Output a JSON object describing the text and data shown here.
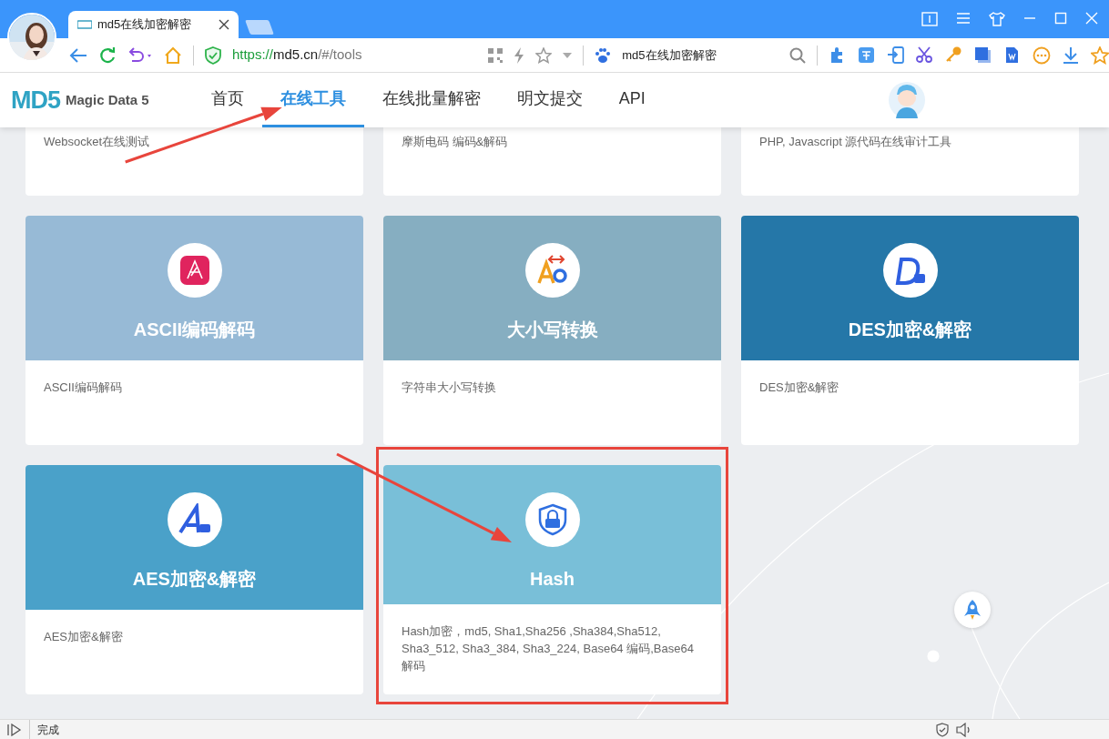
{
  "browser": {
    "tabs": [
      {
        "title": "md5在线加密解密",
        "selected": true
      }
    ],
    "address": {
      "scheme": "https://",
      "host": "md5.cn",
      "path": "/#/tools"
    },
    "search": {
      "value": "md5在线加密解密"
    }
  },
  "site": {
    "logo": {
      "mark": "MD5",
      "name": "Magic Data 5"
    },
    "nav": [
      {
        "label": "首页",
        "selected": false,
        "pointed": false
      },
      {
        "label": "在线工具",
        "selected": true,
        "pointed": true
      },
      {
        "label": "在线批量解密",
        "selected": false,
        "pointed": false
      },
      {
        "label": "明文提交",
        "selected": false,
        "pointed": false
      },
      {
        "label": "API",
        "selected": false,
        "pointed": false
      }
    ]
  },
  "tools": {
    "partial_cards": [
      {
        "description": "Websocket在线测试"
      },
      {
        "description": "摩斯电码 编码&解码"
      },
      {
        "description": "PHP, Javascript 源代码在线审计工具"
      }
    ],
    "cards": [
      {
        "title": "ASCII编码解码",
        "description": "ASCII编码解码",
        "color": "#97bad6",
        "highlighted": false,
        "pointed": false
      },
      {
        "title": "大小写转换",
        "description": "字符串大小写转换",
        "color": "#86aec1",
        "highlighted": false,
        "pointed": false
      },
      {
        "title": "DES加密&解密",
        "description": "DES加密&解密",
        "color": "#2577a8",
        "highlighted": false,
        "pointed": false
      },
      {
        "title": "AES加密&解密",
        "description": "AES加密&解密",
        "color": "#4aa1c9",
        "highlighted": false,
        "pointed": false
      },
      {
        "title": "Hash",
        "description": "Hash加密，md5, Sha1,Sha256 ,Sha384,Sha512, Sha3_512, Sha3_384, Sha3_224, Base64 编码,Base64 解码",
        "color": "#79bfd8",
        "highlighted": true,
        "pointed": true
      }
    ]
  },
  "status_bar": {
    "text": "完成"
  }
}
